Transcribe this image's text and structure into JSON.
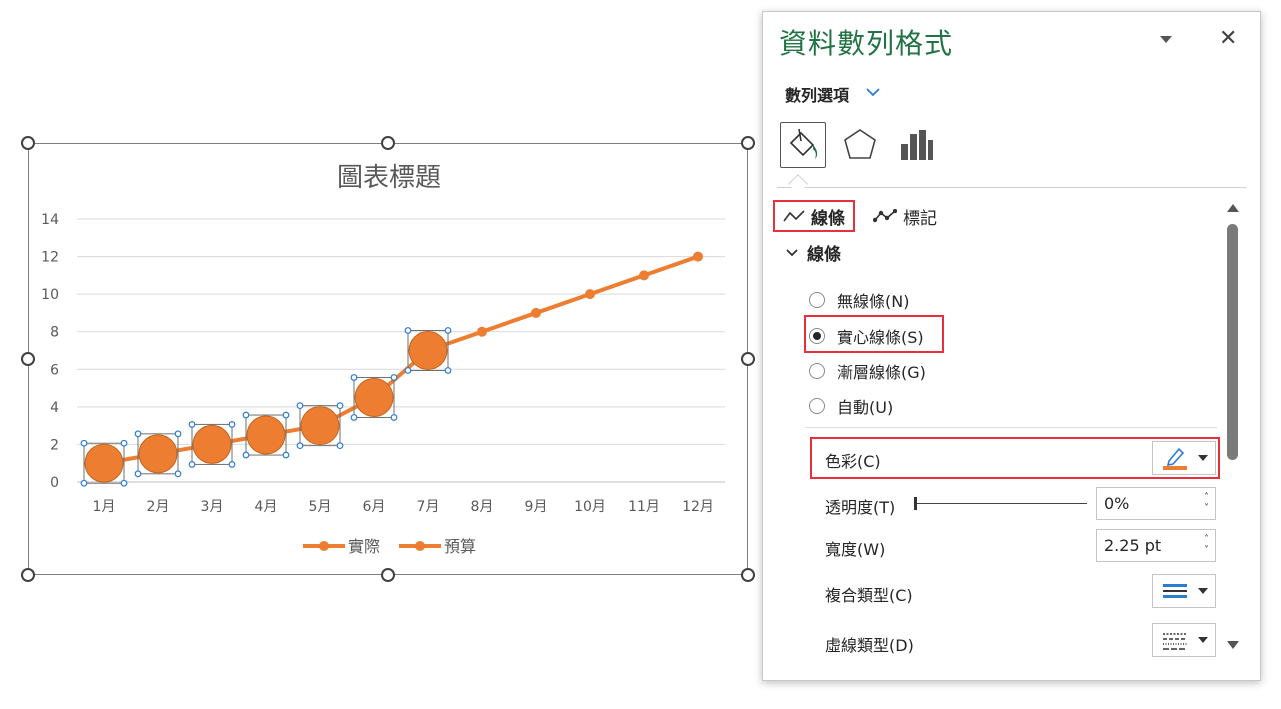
{
  "chart_data": {
    "type": "line",
    "title": "圖表標題",
    "categories": [
      "1月",
      "2月",
      "3月",
      "4月",
      "5月",
      "6月",
      "7月",
      "8月",
      "9月",
      "10月",
      "11月",
      "12月"
    ],
    "series": [
      {
        "name": "實際",
        "values": [
          1,
          1.5,
          2,
          2.5,
          3,
          4.5,
          7,
          null,
          null,
          null,
          null,
          null
        ]
      },
      {
        "name": "預算",
        "values": [
          1,
          1.5,
          2,
          2.5,
          3,
          4.5,
          7,
          8,
          9,
          10,
          11,
          12
        ]
      }
    ],
    "ylim": [
      0,
      14
    ],
    "yticks": [
      0,
      2,
      4,
      6,
      8,
      10,
      12,
      14
    ],
    "grid": true,
    "legend": "bottom",
    "colors": {
      "line": "#ed7d31",
      "gridline": "#d9d9d9",
      "axis_text": "#595959"
    }
  },
  "panel": {
    "title": "資料數列格式",
    "series_options": "數列選項",
    "tabs": {
      "line": "線條",
      "marker": "標記"
    },
    "section": "線條",
    "radios": [
      {
        "label": "無線條(N)",
        "checked": false
      },
      {
        "label": "實心線條(S)",
        "checked": true
      },
      {
        "label": "漸層線條(G)",
        "checked": false
      },
      {
        "label": "自動(U)",
        "checked": false
      }
    ],
    "color_label": "色彩(C)",
    "transparency_label": "透明度(T)",
    "transparency_value": "0%",
    "width_label": "寬度(W)",
    "width_value": "2.25 pt",
    "compound_label": "複合類型(C)",
    "dash_label": "虛線類型(D)",
    "accent_color": "#217346",
    "highlight_color": "#e8303c"
  }
}
